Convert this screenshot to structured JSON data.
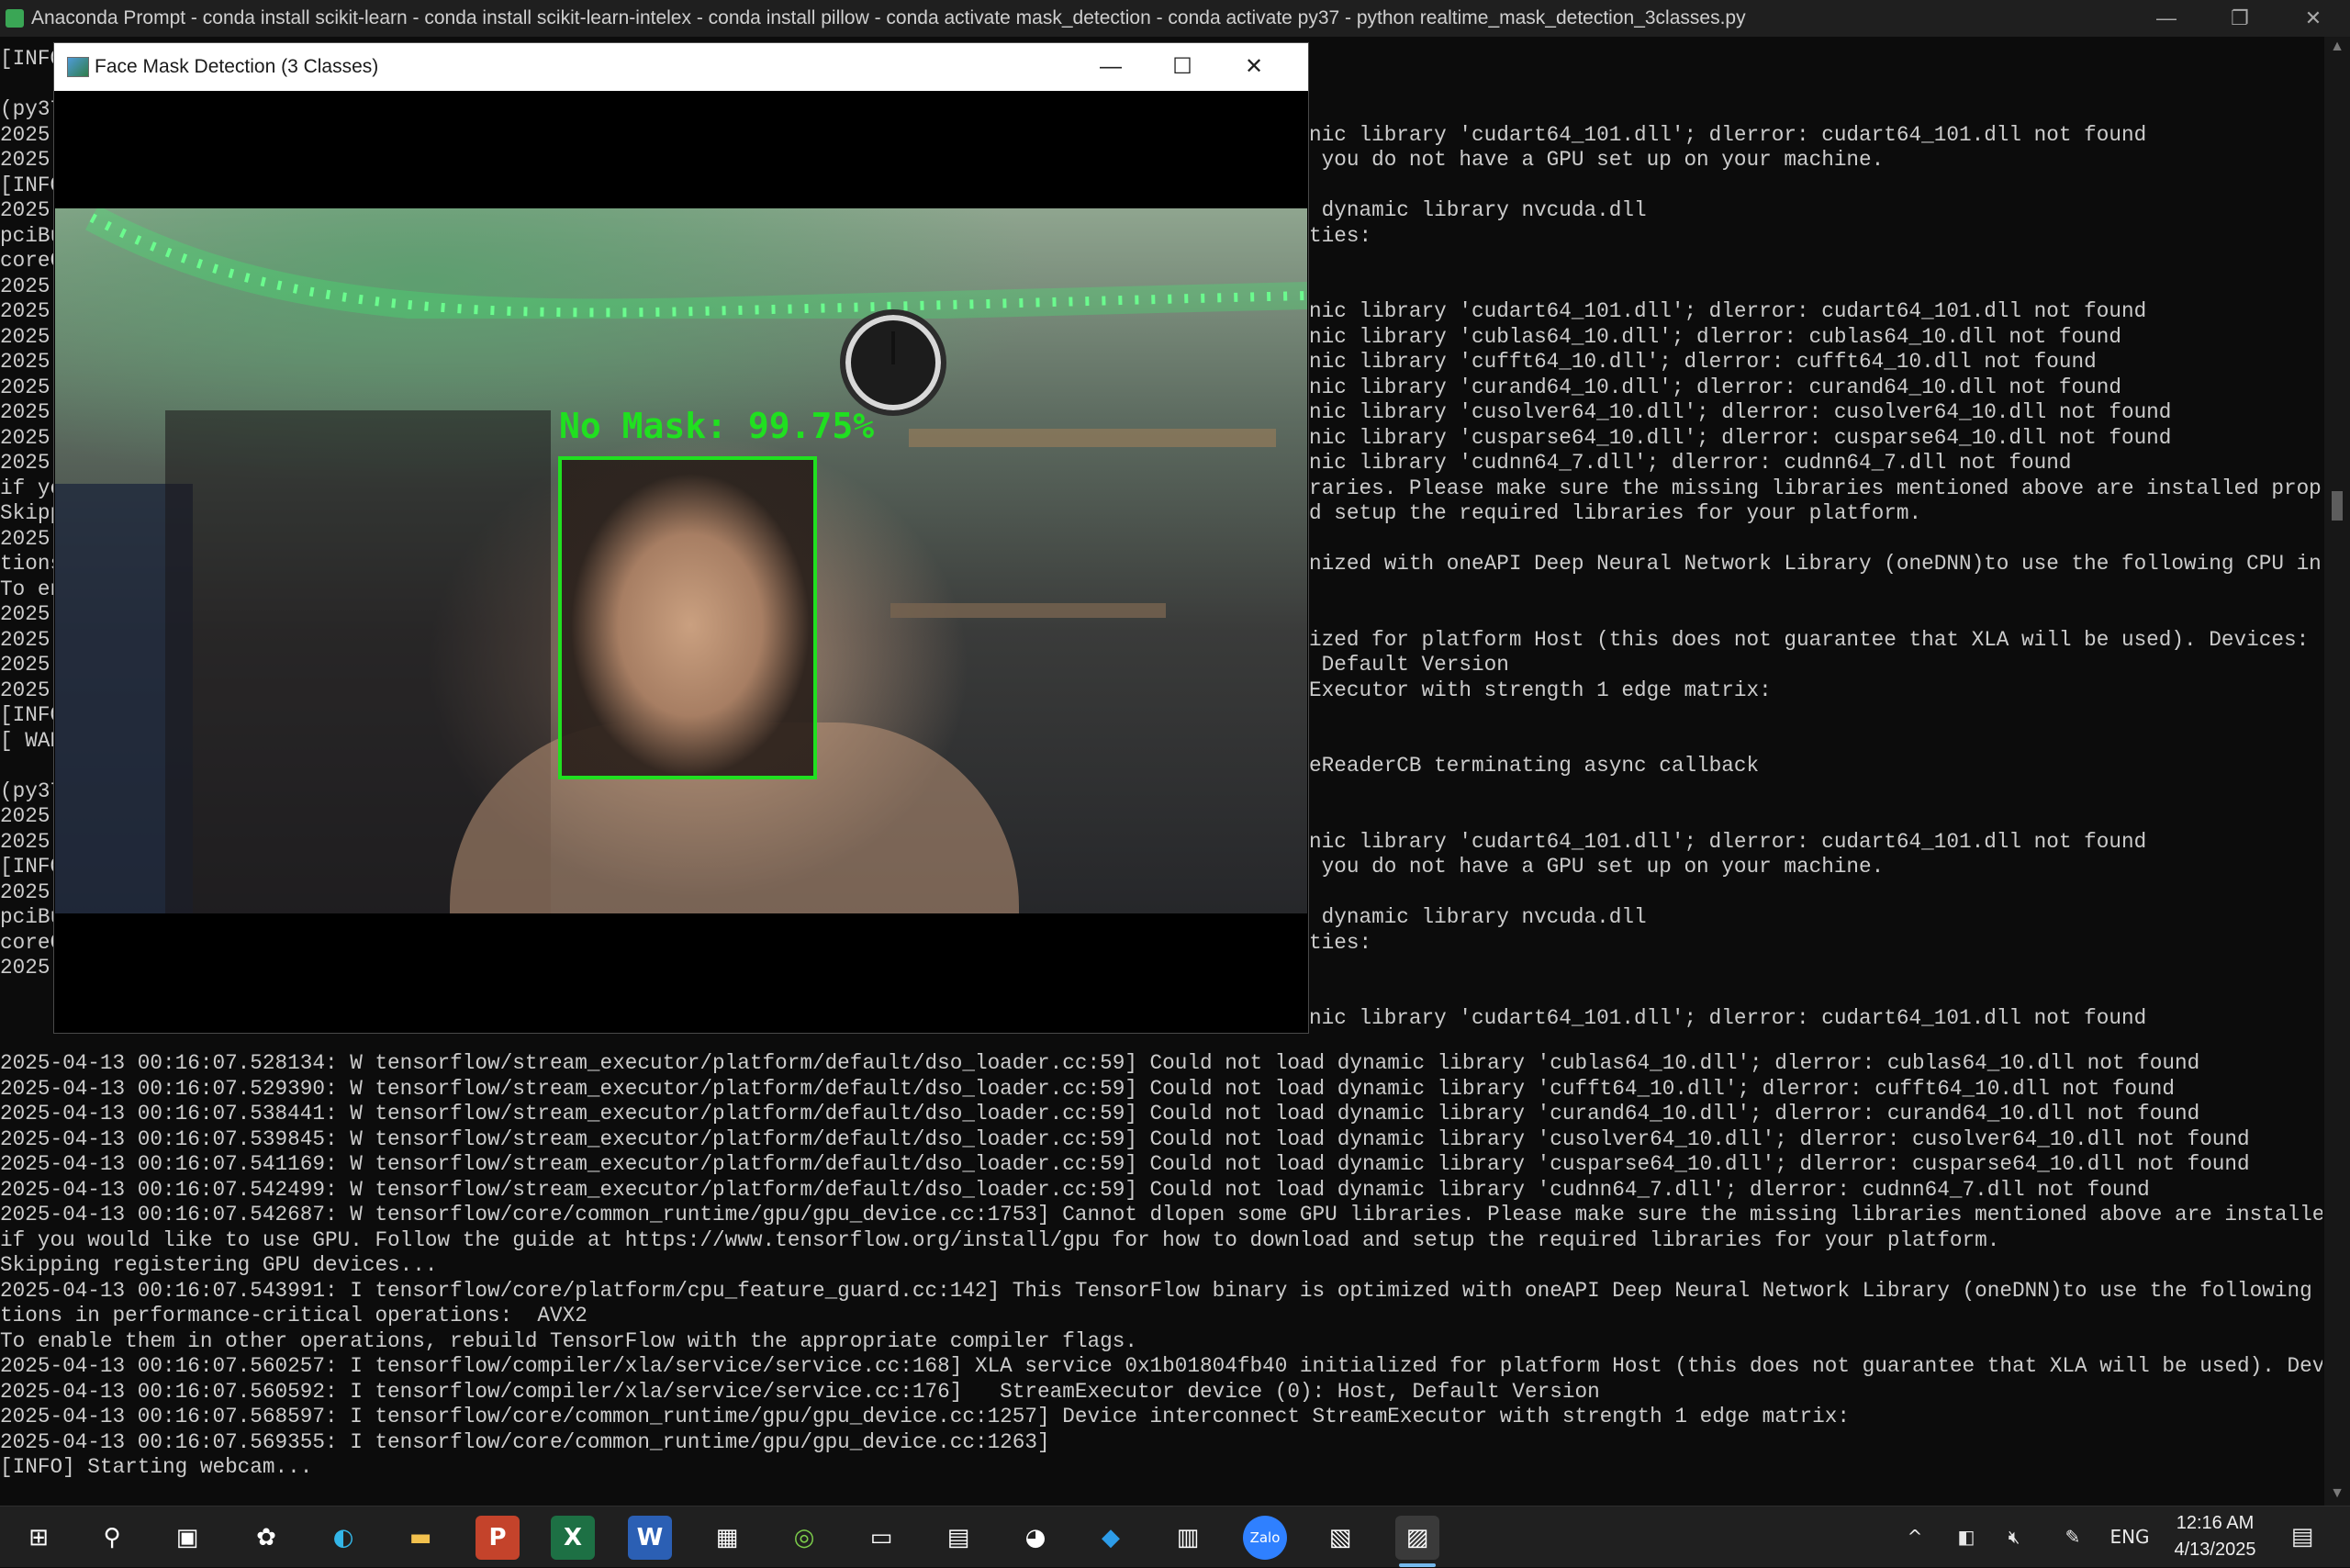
{
  "console": {
    "title": "Anaconda Prompt - conda  install scikit-learn - conda  install scikit-learn-intelex - conda  install pillow - conda  activate mask_detection - conda  activate py37 - python  realtime_mask_detection_3classes.py",
    "controls": {
      "minimize": "—",
      "maximize": "❐",
      "close": "✕"
    },
    "visible_left_fragments": [
      "[INFO",
      "",
      "(py37",
      "2025-",
      "2025-",
      "[INFO",
      "2025-",
      "pciBu",
      "coreC",
      "2025-",
      "2025-",
      "2025-",
      "2025-",
      "2025-",
      "2025-",
      "2025-",
      "2025-",
      "if yo",
      "Skipp",
      "2025-",
      "tions",
      "To en",
      "2025-",
      "2025-",
      "2025-",
      "2025-",
      "[INFO",
      "[ WAR",
      "",
      "(py37",
      "2025-",
      "2025-",
      "[INFO",
      "2025-",
      "pciBu",
      "coreC",
      "2025-"
    ],
    "visible_right_fragments": [
      "",
      "",
      "",
      "nic library 'cudart64_101.dll'; dlerror: cudart64_101.dll not found",
      " you do not have a GPU set up on your machine.",
      "",
      " dynamic library nvcuda.dll",
      "ties:",
      "",
      "",
      "nic library 'cudart64_101.dll'; dlerror: cudart64_101.dll not found",
      "nic library 'cublas64_10.dll'; dlerror: cublas64_10.dll not found",
      "nic library 'cufft64_10.dll'; dlerror: cufft64_10.dll not found",
      "nic library 'curand64_10.dll'; dlerror: curand64_10.dll not found",
      "nic library 'cusolver64_10.dll'; dlerror: cusolver64_10.dll not found",
      "nic library 'cusparse64_10.dll'; dlerror: cusparse64_10.dll not found",
      "nic library 'cudnn64_7.dll'; dlerror: cudnn64_7.dll not found",
      "raries. Please make sure the missing libraries mentioned above are installed properly",
      "d setup the required libraries for your platform.",
      "",
      "nized with oneAPI Deep Neural Network Library (oneDNN)to use the following CPU instruc",
      "",
      "",
      "ized for platform Host (this does not guarantee that XLA will be used). Devices:",
      " Default Version",
      "Executor with strength 1 edge matrix:",
      "",
      "",
      "eReaderCB terminating async callback",
      "",
      "",
      "nic library 'cudart64_101.dll'; dlerror: cudart64_101.dll not found",
      " you do not have a GPU set up on your machine.",
      "",
      " dynamic library nvcuda.dll",
      "ties:",
      "",
      "",
      "nic library 'cudart64_101.dll'; dlerror: cudart64_101.dll not found"
    ],
    "full_lines": [
      "2025-04-13 00:16:07.528134: W tensorflow/stream_executor/platform/default/dso_loader.cc:59] Could not load dynamic library 'cublas64_10.dll'; dlerror: cublas64_10.dll not found",
      "2025-04-13 00:16:07.529390: W tensorflow/stream_executor/platform/default/dso_loader.cc:59] Could not load dynamic library 'cufft64_10.dll'; dlerror: cufft64_10.dll not found",
      "2025-04-13 00:16:07.538441: W tensorflow/stream_executor/platform/default/dso_loader.cc:59] Could not load dynamic library 'curand64_10.dll'; dlerror: curand64_10.dll not found",
      "2025-04-13 00:16:07.539845: W tensorflow/stream_executor/platform/default/dso_loader.cc:59] Could not load dynamic library 'cusolver64_10.dll'; dlerror: cusolver64_10.dll not found",
      "2025-04-13 00:16:07.541169: W tensorflow/stream_executor/platform/default/dso_loader.cc:59] Could not load dynamic library 'cusparse64_10.dll'; dlerror: cusparse64_10.dll not found",
      "2025-04-13 00:16:07.542499: W tensorflow/stream_executor/platform/default/dso_loader.cc:59] Could not load dynamic library 'cudnn64_7.dll'; dlerror: cudnn64_7.dll not found",
      "2025-04-13 00:16:07.542687: W tensorflow/core/common_runtime/gpu/gpu_device.cc:1753] Cannot dlopen some GPU libraries. Please make sure the missing libraries mentioned above are installed properly",
      "if you would like to use GPU. Follow the guide at https://www.tensorflow.org/install/gpu for how to download and setup the required libraries for your platform.",
      "Skipping registering GPU devices...",
      "2025-04-13 00:16:07.543991: I tensorflow/core/platform/cpu_feature_guard.cc:142] This TensorFlow binary is optimized with oneAPI Deep Neural Network Library (oneDNN)to use the following CPU instruc",
      "tions in performance-critical operations:  AVX2",
      "To enable them in other operations, rebuild TensorFlow with the appropriate compiler flags.",
      "2025-04-13 00:16:07.560257: I tensorflow/compiler/xla/service/service.cc:168] XLA service 0x1b01804fb40 initialized for platform Host (this does not guarantee that XLA will be used). Devices:",
      "2025-04-13 00:16:07.560592: I tensorflow/compiler/xla/service/service.cc:176]   StreamExecutor device (0): Host, Default Version",
      "2025-04-13 00:16:07.568597: I tensorflow/core/common_runtime/gpu/gpu_device.cc:1257] Device interconnect StreamExecutor with strength 1 edge matrix:",
      "2025-04-13 00:16:07.569355: I tensorflow/core/common_runtime/gpu/gpu_device.cc:1263]",
      "[INFO] Starting webcam..."
    ]
  },
  "detection_window": {
    "title": "Face Mask Detection (3 Classes)",
    "controls": {
      "minimize": "—",
      "maximize": "☐",
      "close": "✕"
    },
    "detection": {
      "label": "No Mask: 99.75%",
      "box_color": "#20e020"
    }
  },
  "taskbar": {
    "apps": [
      {
        "name": "start-icon",
        "glyph": "⊞"
      },
      {
        "name": "search-icon",
        "glyph": "⚲"
      },
      {
        "name": "task-view-icon",
        "glyph": "▣"
      },
      {
        "name": "copilot-icon",
        "glyph": "✿"
      },
      {
        "name": "edge-icon",
        "glyph": "◐"
      },
      {
        "name": "file-explorer-icon",
        "glyph": "▬"
      },
      {
        "name": "powerpoint-icon",
        "glyph": "P"
      },
      {
        "name": "excel-icon",
        "glyph": "X"
      },
      {
        "name": "word-icon",
        "glyph": "W"
      },
      {
        "name": "photos-icon",
        "glyph": "▦"
      },
      {
        "name": "camtasia-icon",
        "glyph": "◎"
      },
      {
        "name": "terminal-icon",
        "glyph": "▭"
      },
      {
        "name": "remote-desktop-icon",
        "glyph": "▤"
      },
      {
        "name": "browser-icon",
        "glyph": "◕"
      },
      {
        "name": "vscode-icon",
        "glyph": "◆"
      },
      {
        "name": "flag-app-icon",
        "glyph": "▥"
      },
      {
        "name": "zalo-icon",
        "glyph": "Zalo"
      },
      {
        "name": "files-icon",
        "glyph": "▧"
      },
      {
        "name": "opencv-window-icon",
        "glyph": "▨"
      }
    ],
    "tray": {
      "language": "ENG",
      "time": "12:16 AM",
      "date": "4/13/2025"
    }
  }
}
